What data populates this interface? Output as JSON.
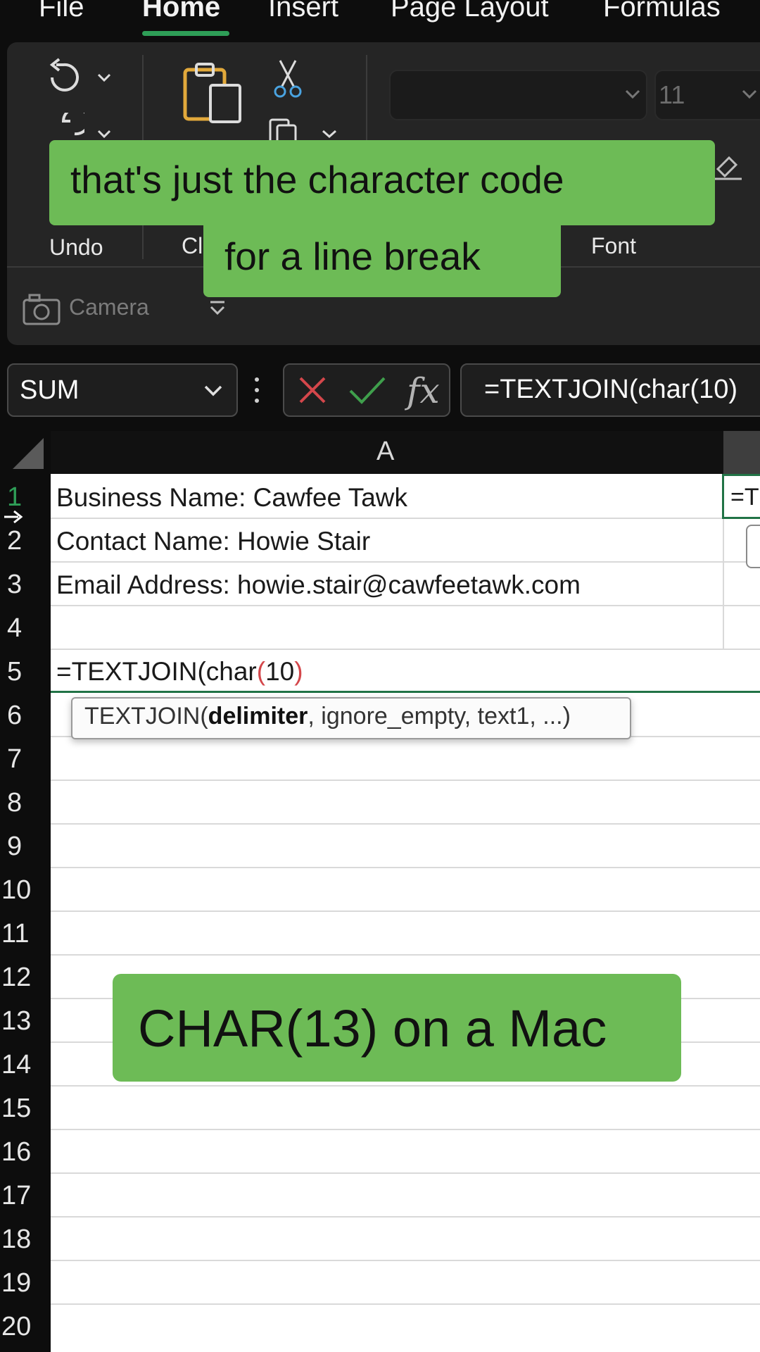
{
  "menu": {
    "tabs": [
      "File",
      "Home",
      "Insert",
      "Page Layout",
      "Formulas"
    ],
    "active": "Home"
  },
  "ribbon": {
    "groups": {
      "undo_label": "Undo",
      "clipboard_label": "Cl",
      "font_label": "Font"
    },
    "font_size_value": "11",
    "camera_label": "Camera"
  },
  "formula_bar": {
    "name_box": "SUM",
    "fx_label": "fx",
    "formula": "=TEXTJOIN(char(10)"
  },
  "sheet": {
    "columns": [
      "A"
    ],
    "rows": [
      "1",
      "2",
      "3",
      "4",
      "5",
      "6",
      "7",
      "8",
      "9",
      "10",
      "11",
      "12",
      "13",
      "14",
      "15",
      "16",
      "17",
      "18",
      "19",
      "20"
    ],
    "cells": {
      "A1": "Business Name: Cawfee Tawk",
      "A2": "Contact Name: Howie Stair",
      "A3": "Email Address: howie.stair@cawfeetawk.com",
      "A5_prefix": "=TEXTJOIN(char",
      "A5_paren_open": "(",
      "A5_arg": "10",
      "A5_paren_close": ")",
      "B1": "=T"
    },
    "tooltip": {
      "prefix": "TEXTJOIN(",
      "bold_arg": "delimiter",
      "rest": ", ignore_empty, text1, ...)"
    }
  },
  "captions": {
    "top_line1": "that's just the character code",
    "top_line2": "for a line break",
    "bottom": "CHAR(13) on a Mac"
  },
  "colors": {
    "accent_green": "#2e9e57",
    "caption_green": "#6dbb56",
    "cancel_red": "#d4474b",
    "enter_green": "#3f9f4c"
  }
}
